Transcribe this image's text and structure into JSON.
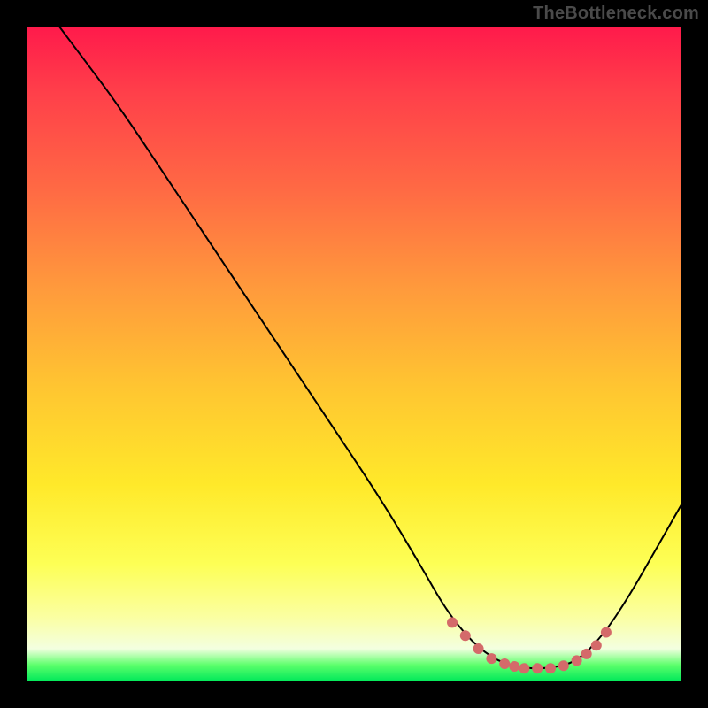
{
  "watermark": "TheBottleneck.com",
  "chart_data": {
    "type": "line",
    "title": "",
    "xlabel": "",
    "ylabel": "",
    "xlim": [
      0,
      100
    ],
    "ylim": [
      0,
      100
    ],
    "grid": false,
    "legend": false,
    "gradient_stops": [
      {
        "offset": 0.0,
        "color": "#ff1a4b"
      },
      {
        "offset": 0.1,
        "color": "#ff3f4a"
      },
      {
        "offset": 0.25,
        "color": "#ff6a44"
      },
      {
        "offset": 0.4,
        "color": "#ff9a3c"
      },
      {
        "offset": 0.55,
        "color": "#ffc531"
      },
      {
        "offset": 0.7,
        "color": "#ffe92a"
      },
      {
        "offset": 0.82,
        "color": "#fdff55"
      },
      {
        "offset": 0.9,
        "color": "#fbffa0"
      },
      {
        "offset": 0.95,
        "color": "#f3ffe0"
      },
      {
        "offset": 0.975,
        "color": "#5cff6b"
      },
      {
        "offset": 1.0,
        "color": "#00e85a"
      }
    ],
    "series": [
      {
        "name": "bottleneck-curve",
        "color": "#000000",
        "width": 2,
        "points": [
          {
            "x": 5,
            "y": 100
          },
          {
            "x": 8,
            "y": 96
          },
          {
            "x": 14,
            "y": 88
          },
          {
            "x": 22,
            "y": 76
          },
          {
            "x": 30,
            "y": 64
          },
          {
            "x": 38,
            "y": 52
          },
          {
            "x": 46,
            "y": 40
          },
          {
            "x": 54,
            "y": 28
          },
          {
            "x": 60,
            "y": 18
          },
          {
            "x": 64,
            "y": 11
          },
          {
            "x": 68,
            "y": 6
          },
          {
            "x": 72,
            "y": 3
          },
          {
            "x": 76,
            "y": 2
          },
          {
            "x": 80,
            "y": 2
          },
          {
            "x": 84,
            "y": 3
          },
          {
            "x": 88,
            "y": 7
          },
          {
            "x": 92,
            "y": 13
          },
          {
            "x": 96,
            "y": 20
          },
          {
            "x": 100,
            "y": 27
          }
        ]
      },
      {
        "name": "optimal-band-markers",
        "color": "#d46a6a",
        "marker_radius": 6,
        "points": [
          {
            "x": 65,
            "y": 9
          },
          {
            "x": 67,
            "y": 7
          },
          {
            "x": 69,
            "y": 5
          },
          {
            "x": 71,
            "y": 3.5
          },
          {
            "x": 73,
            "y": 2.7
          },
          {
            "x": 74.5,
            "y": 2.3
          },
          {
            "x": 76,
            "y": 2
          },
          {
            "x": 78,
            "y": 2
          },
          {
            "x": 80,
            "y": 2
          },
          {
            "x": 82,
            "y": 2.4
          },
          {
            "x": 84,
            "y": 3.2
          },
          {
            "x": 85.5,
            "y": 4.2
          },
          {
            "x": 87,
            "y": 5.5
          },
          {
            "x": 88.5,
            "y": 7.5
          }
        ]
      }
    ]
  }
}
